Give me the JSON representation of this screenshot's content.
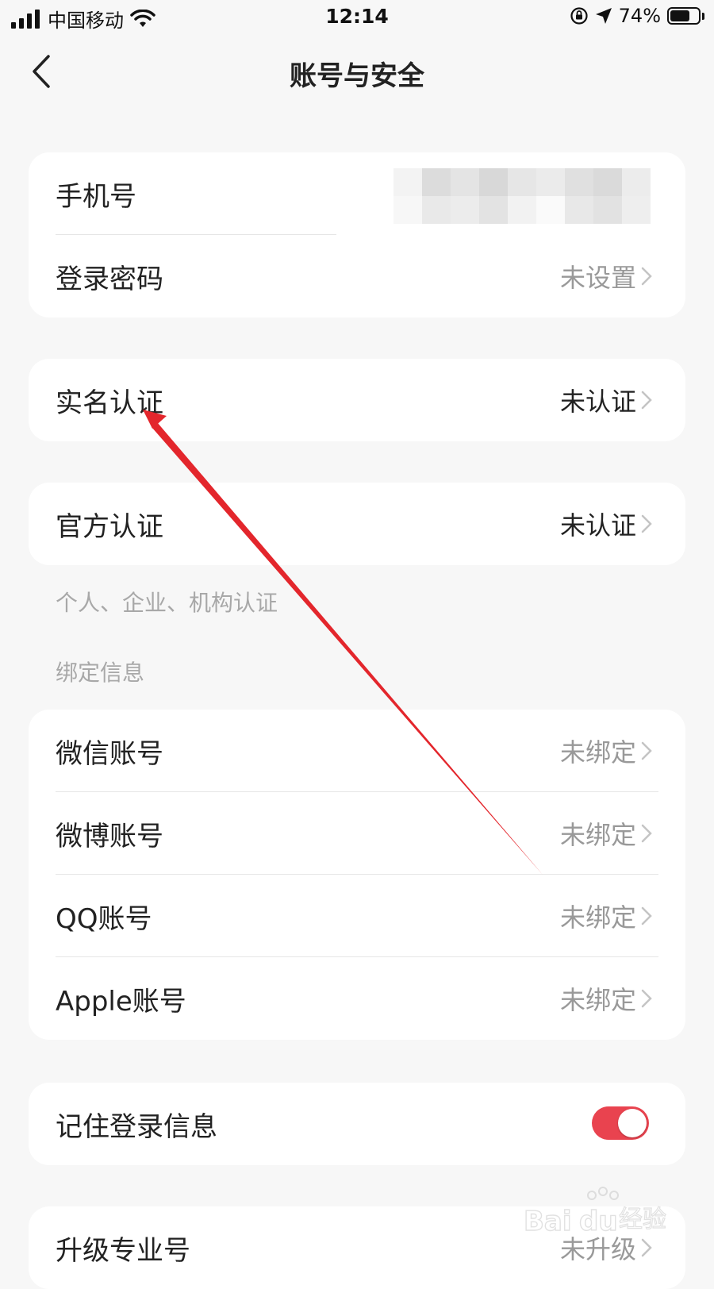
{
  "status_bar": {
    "carrier": "中国移动",
    "time": "12:14",
    "battery_percent": "74%",
    "battery_level": 0.74,
    "icons": [
      "signal-icon",
      "wifi-icon",
      "orientation-lock-icon",
      "location-icon",
      "battery-icon"
    ]
  },
  "nav": {
    "title": "账号与安全",
    "back_icon": "chevron-left-icon"
  },
  "account": {
    "phone_label": "手机号",
    "password_label": "登录密码",
    "password_value": "未设置"
  },
  "realname": {
    "label": "实名认证",
    "value": "未认证"
  },
  "official": {
    "label": "官方认证",
    "value": "未认证",
    "note": "个人、企业、机构认证"
  },
  "bind": {
    "section_title": "绑定信息",
    "items": [
      {
        "label": "微信账号",
        "value": "未绑定"
      },
      {
        "label": "微博账号",
        "value": "未绑定"
      },
      {
        "label": "QQ账号",
        "value": "未绑定"
      },
      {
        "label": "Apple账号",
        "value": "未绑定"
      }
    ]
  },
  "remember": {
    "label": "记住登录信息",
    "enabled": true
  },
  "upgrade": {
    "label": "升级专业号",
    "value": "未升级"
  },
  "watermark": {
    "text": "Baidu经验"
  },
  "colors": {
    "background": "#f7f7f7",
    "card": "#ffffff",
    "toggle_on": "#e9434f",
    "annotation_arrow": "#e3262c",
    "muted_text": "#999999"
  }
}
